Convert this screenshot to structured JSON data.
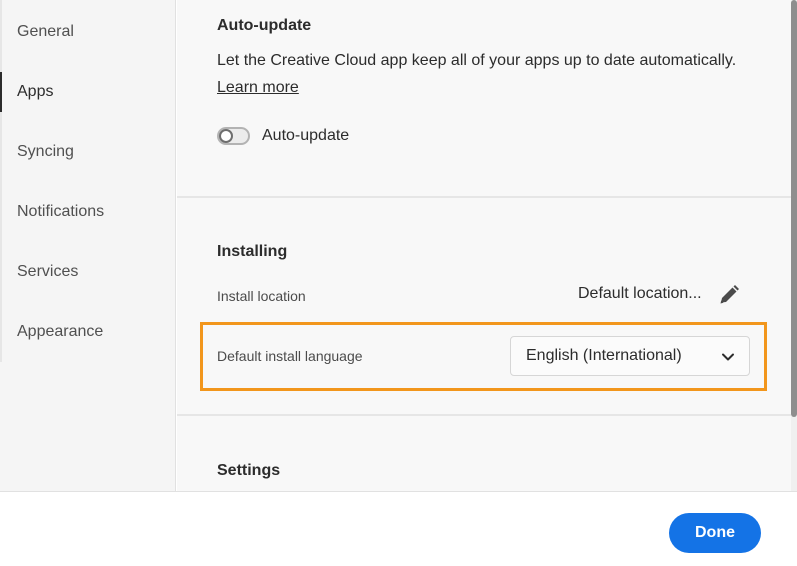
{
  "sidebar": {
    "items": [
      {
        "label": "General"
      },
      {
        "label": "Apps"
      },
      {
        "label": "Syncing"
      },
      {
        "label": "Notifications"
      },
      {
        "label": "Services"
      },
      {
        "label": "Appearance"
      }
    ],
    "active": "Apps"
  },
  "auto_update": {
    "title": "Auto-update",
    "description": "Let the Creative Cloud app keep all of your apps up to date automatically.",
    "learn_more": "Learn more",
    "toggle_label": "Auto-update",
    "toggle_on": false
  },
  "installing": {
    "title": "Installing",
    "location_label": "Install location",
    "location_value": "Default location...",
    "language_label": "Default install language",
    "language_value": "English (International)"
  },
  "settings": {
    "title": "Settings"
  },
  "footer": {
    "done_label": "Done"
  },
  "colors": {
    "accent": "#1473e6",
    "highlight": "#f2961c"
  }
}
